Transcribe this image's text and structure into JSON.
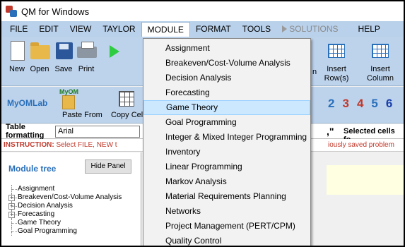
{
  "window": {
    "title": "QM for Windows"
  },
  "menubar": {
    "items": [
      "FILE",
      "EDIT",
      "VIEW",
      "TAYLOR",
      "MODULE",
      "FORMAT",
      "TOOLS",
      "SOLUTIONS",
      "HELP"
    ],
    "open": "MODULE",
    "disabled": [
      "SOLUTIONS"
    ]
  },
  "toolbar": {
    "new": "New",
    "open": "Open",
    "save": "Save",
    "print": "Print",
    "insert_rows": "Insert\nRow(s)",
    "insert_cols": "Insert\nColumn",
    "partial_n": "n"
  },
  "toolbar2": {
    "myomlab": "MyOMLab",
    "myom_small": "MyOM",
    "paste_from": "Paste From",
    "copy_cells": "Copy Cel",
    "numbers": [
      "2",
      "3",
      "4",
      "5",
      "6"
    ],
    "number_colors": [
      "#2a6fba",
      "#c0392b",
      "#c0392b",
      "#2a6fba",
      "#1a3fa8"
    ]
  },
  "formatbar": {
    "label": "Table formatting",
    "font": "Arial",
    "comma_partial": ",\"",
    "selected_cells": "Selected cells fo"
  },
  "instruction": {
    "prefix": "INSTRUCTION:",
    "text": " Select FILE, NEW t",
    "tail": "iously saved problem"
  },
  "left_panel": {
    "title": "Module tree",
    "hide_button": "Hide Panel",
    "tree": [
      {
        "label": "Assignment",
        "expandable": false
      },
      {
        "label": "Breakeven/Cost-Volume Analysis",
        "expandable": true
      },
      {
        "label": "Decision Analysis",
        "expandable": true
      },
      {
        "label": "Forecasting",
        "expandable": true
      },
      {
        "label": "Game Theory",
        "expandable": false
      },
      {
        "label": "Goal Programming",
        "expandable": false
      }
    ]
  },
  "module_menu": {
    "highlighted": "Game Theory",
    "items": [
      "Assignment",
      "Breakeven/Cost-Volume Analysis",
      "Decision Analysis",
      "Forecasting",
      "Game Theory",
      "Goal Programming",
      "Integer & Mixed Integer Programming",
      "Inventory",
      "Linear Programming",
      "Markov Analysis",
      "Material Requirements Planning",
      "Networks",
      "Project Management (PERT/CPM)",
      "Quality Control"
    ]
  }
}
